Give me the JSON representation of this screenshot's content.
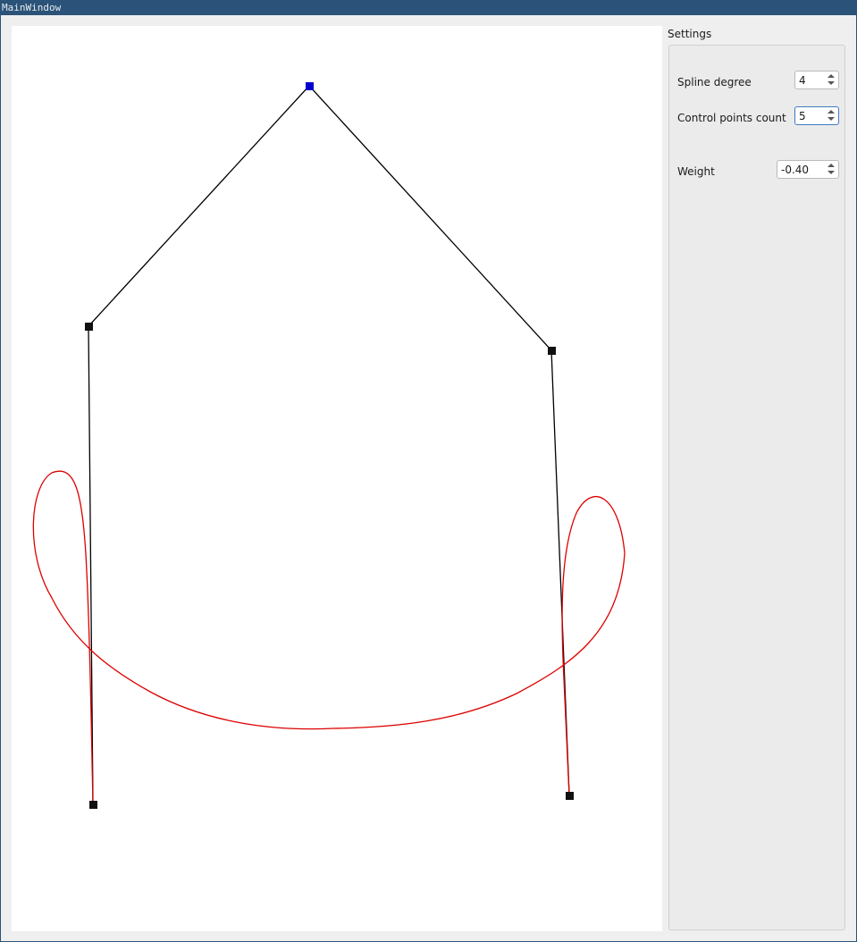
{
  "window": {
    "title": "MainWindow"
  },
  "settings": {
    "title": "Settings",
    "spline_degree": {
      "label": "Spline degree",
      "value": "4"
    },
    "control_points_count": {
      "label": "Control points count",
      "value": "5"
    },
    "weight": {
      "label": "Weight",
      "value": "-0.40"
    }
  },
  "colors": {
    "control_polygon": "#000000",
    "control_point": "#000000",
    "selected_control_point": "#0000cc",
    "curve": "#dd0000"
  }
}
